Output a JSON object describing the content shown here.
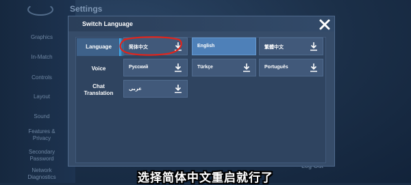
{
  "background": {
    "title": "Settings",
    "menu": [
      "Graphics",
      "In-Match",
      "Controls",
      "Layout",
      "Sound",
      "Features &\nPrivacy",
      "Secondary\nPassword",
      "Network\nDiagnostics"
    ],
    "bottom_right": "Log Out"
  },
  "dialog": {
    "title": "Switch Language",
    "tabs": [
      {
        "label": "Language",
        "active": true
      },
      {
        "label": "Voice"
      },
      {
        "label": "Chat\nTranslation"
      }
    ],
    "languages": [
      {
        "label": "简体中文",
        "selected": false,
        "icon": "download-icon"
      },
      {
        "label": "English",
        "selected": true,
        "icon": null
      },
      {
        "label": "繁體中文",
        "selected": false,
        "icon": "download-icon"
      },
      {
        "label": "Русский",
        "selected": false,
        "icon": "download-icon"
      },
      {
        "label": "Türkçe",
        "selected": false,
        "icon": "download-icon"
      },
      {
        "label": "Português",
        "selected": false,
        "icon": "download-icon"
      },
      {
        "label": "عربي",
        "selected": false,
        "icon": "download-icon"
      }
    ]
  },
  "annotation_color": "#e0241b",
  "subtitle": "选择简体中文重启就行了"
}
